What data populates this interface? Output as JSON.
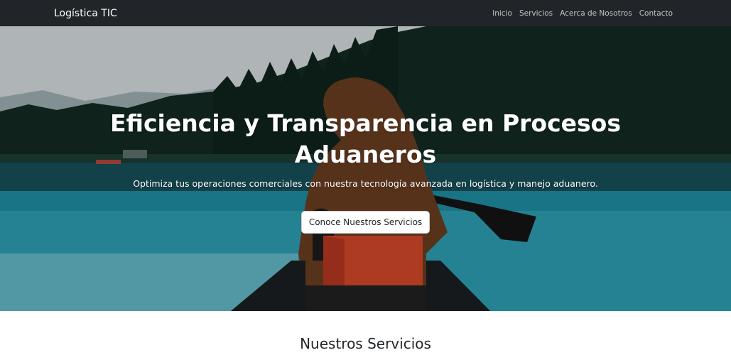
{
  "navbar": {
    "brand": "Logística TIC",
    "links": [
      "Inicio",
      "Servicios",
      "Acerca de Nosotros",
      "Contacto"
    ]
  },
  "hero": {
    "title": "Eficiencia y Transparencia en Procesos Aduaneros",
    "subtitle": "Optimiza tus operaciones comerciales con nuestra tecnología avanzada en logística y manejo aduanero.",
    "button_label": "Conoce Nuestros Servicios"
  },
  "services": {
    "title": "Nuestros Servicios"
  },
  "colors": {
    "navbar_bg": "#212529",
    "hero_text": "#ffffff",
    "button_bg": "#ffffff"
  }
}
